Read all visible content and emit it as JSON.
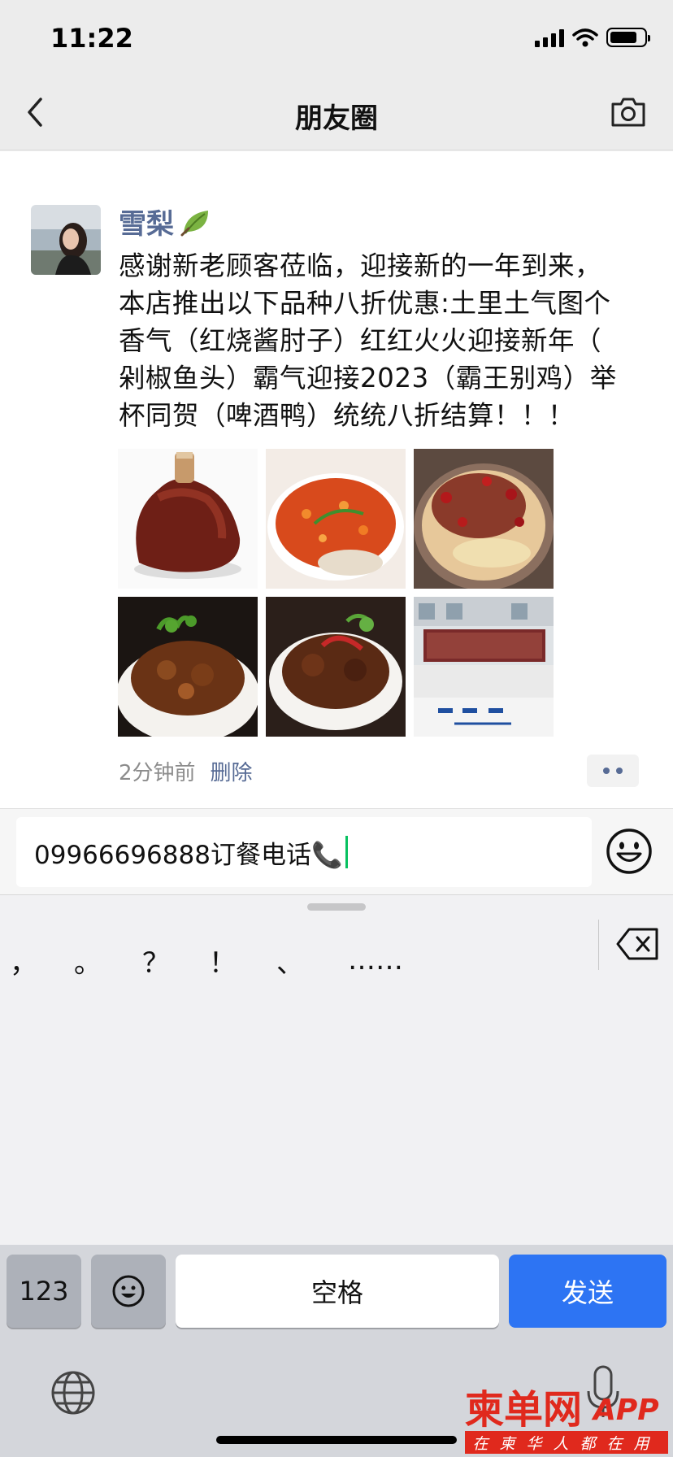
{
  "status_bar": {
    "time": "11:22"
  },
  "nav": {
    "title": "朋友圈"
  },
  "post": {
    "author": "雪梨",
    "text": "感谢新老顾客莅临，迎接新的一年到来，\n本店推出以下品种八折优惠:土里土气图个\n香气（红烧酱肘子）红红火火迎接新年（\n剁椒鱼头）霸气迎接2023（霸王别鸡）举\n杯同贺（啤酒鸭）统统八折结算！！！",
    "photos": [
      "braised-pork-knuckle-photo",
      "chopped-pepper-fish-head-photo",
      "spicy-chicken-bowl-photo",
      "braised-duck-photo",
      "beer-duck-photo",
      "restaurant-storefront-photo"
    ],
    "time_ago": "2分钟前",
    "delete_label": "删除"
  },
  "comment": {
    "value": "09966696888订餐电话📞"
  },
  "keyboard": {
    "punctuation": [
      "，",
      "。",
      "？",
      "！",
      "、",
      "……"
    ],
    "key_123": "123",
    "space_label": "空格",
    "send_label": "发送",
    "send_color": "#2d74f3"
  },
  "watermark": {
    "logo_text": "柬单网APP",
    "slogan": "在柬华人都在用"
  }
}
